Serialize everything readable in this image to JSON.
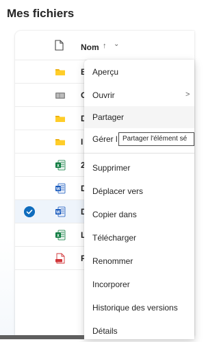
{
  "page": {
    "title": "Mes fichiers"
  },
  "list": {
    "column_name": "Nom",
    "sort_arrow": "↑",
    "sort_chevron": "⌄",
    "rows": [
      {
        "icon": "folder-icon",
        "name_visible": "B"
      },
      {
        "icon": "album-icon",
        "name_visible": "C"
      },
      {
        "icon": "folder-icon",
        "name_visible": "D"
      },
      {
        "icon": "folder-icon",
        "name_visible": "I"
      },
      {
        "icon": "excel-icon",
        "name_visible": "2"
      },
      {
        "icon": "word-icon",
        "name_visible": "D"
      },
      {
        "icon": "word-icon",
        "name_visible": "D",
        "selected": true
      },
      {
        "icon": "excel-icon",
        "name_visible": "L"
      },
      {
        "icon": "pdf-icon",
        "name_visible": "P"
      }
    ]
  },
  "menu": {
    "items": [
      {
        "label": "Aperçu"
      },
      {
        "label": "Ouvrir",
        "submenu": true,
        "chevron": ">"
      },
      {
        "label": "Partager",
        "hover": true
      },
      {
        "label": "Gérer l"
      },
      {
        "label": "Supprimer"
      },
      {
        "label": "Déplacer vers"
      },
      {
        "label": "Copier dans"
      },
      {
        "label": "Télécharger"
      },
      {
        "label": "Renommer"
      },
      {
        "label": "Incorporer"
      },
      {
        "label": "Historique des versions"
      },
      {
        "label": "Détails"
      }
    ]
  },
  "tooltip": {
    "text": "Partager l'élément sé"
  },
  "colors": {
    "accent": "#0f6cbd",
    "folder": "#ffcd29",
    "excel": "#107c41",
    "word": "#185abd",
    "pdf": "#d13438"
  }
}
